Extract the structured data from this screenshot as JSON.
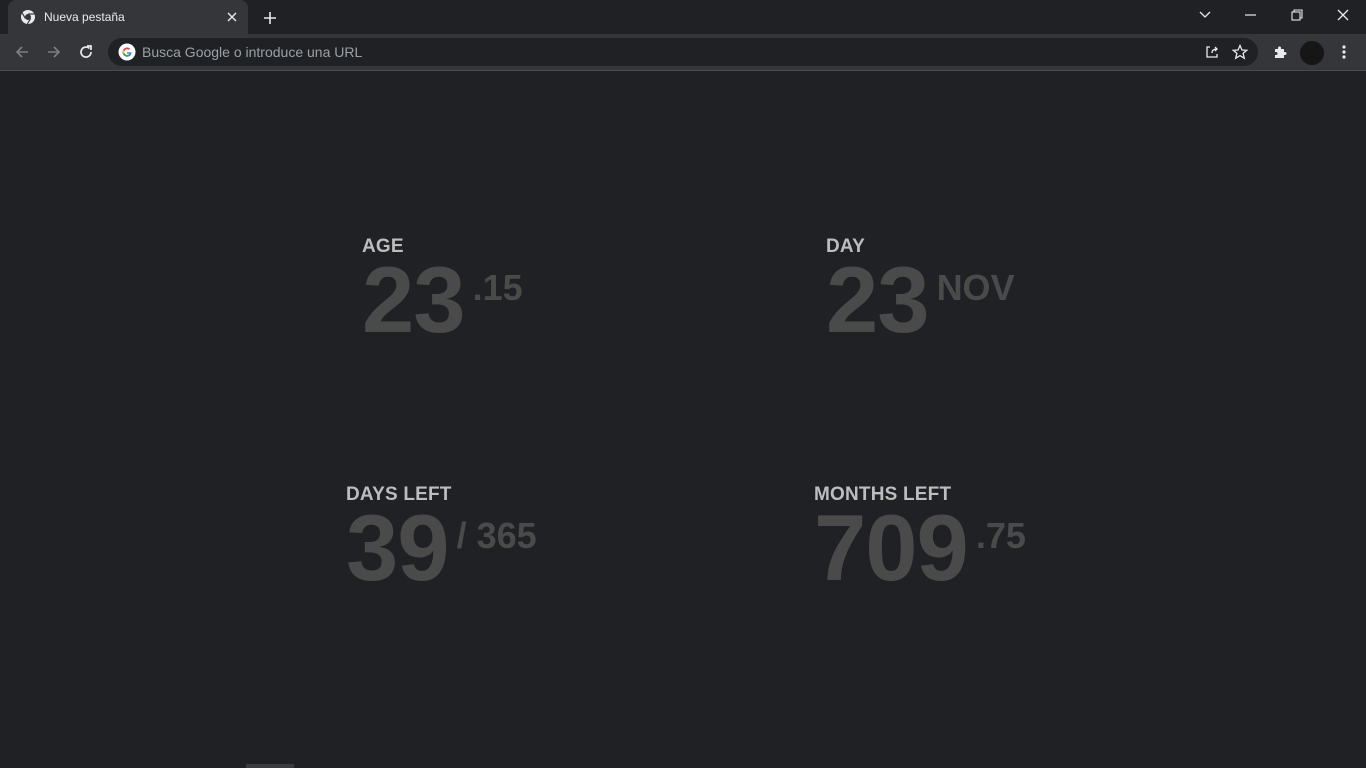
{
  "browser": {
    "tab_title": "Nueva pestaña",
    "omnibox_placeholder": "Busca Google o introduce una URL",
    "accent": "#202124",
    "toolbar_color": "#35363a"
  },
  "icons": {
    "favicon": "chrome-icon",
    "tab_close": "close-icon",
    "new_tab": "plus-icon",
    "tab_search": "chevron-down-icon",
    "minimize": "minimize-icon",
    "restore": "restore-icon",
    "window_close": "close-icon",
    "back": "arrow-left-icon",
    "forward": "arrow-right-icon",
    "reload": "reload-icon",
    "google": "google-icon",
    "share": "share-icon",
    "bookmark": "star-icon",
    "extensions": "puzzle-icon",
    "menu": "kebab-icon"
  },
  "stats": {
    "age": {
      "label": "AGE",
      "value": "23",
      "suffix": ".15"
    },
    "day": {
      "label": "DAY",
      "value": "23",
      "suffix": "NOV"
    },
    "days_left": {
      "label": "DAYS LEFT",
      "value": "39",
      "suffix": "/ 365"
    },
    "months_left": {
      "label": "MONTHS LEFT",
      "value": "709",
      "suffix": ".75"
    }
  }
}
